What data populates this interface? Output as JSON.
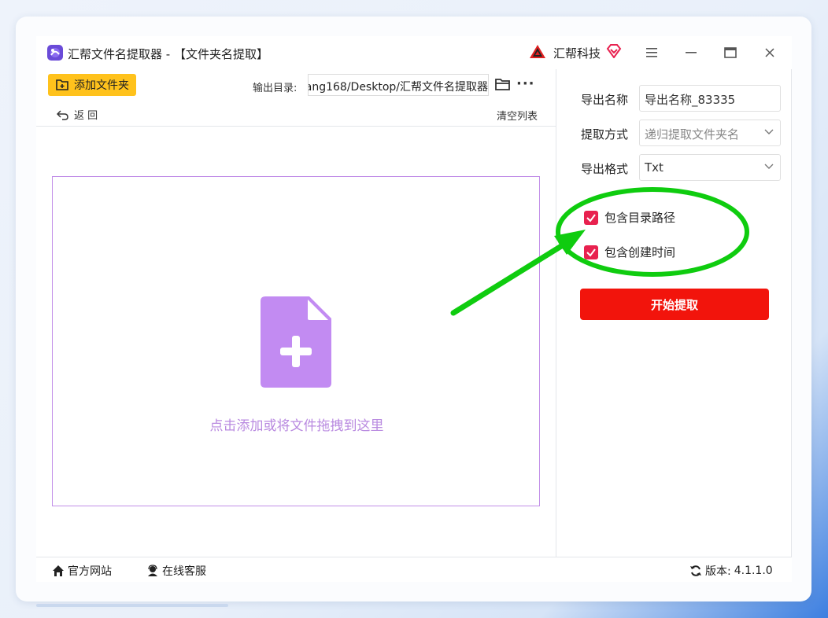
{
  "window": {
    "title": "汇帮文件名提取器 - 【文件夹名提取】",
    "brand_name": "汇帮科技"
  },
  "toolbar": {
    "add_folder_label": "添加文件夹",
    "output_dir_label": "输出目录:",
    "output_dir_value": "ang168/Desktop/汇帮文件名提取器",
    "back_label": "返 回",
    "clear_list_label": "清空列表"
  },
  "dropzone": {
    "hint": "点击添加或将文件拖拽到这里"
  },
  "settings": {
    "export_name_label": "导出名称",
    "export_name_value": "导出名称_83335",
    "extract_mode_label": "提取方式",
    "extract_mode_value": "递归提取文件夹名",
    "export_format_label": "导出格式",
    "export_format_value": "Txt",
    "include_dir_path_label": "包含目录路径",
    "include_dir_path_checked": true,
    "include_create_time_label": "包含创建时间",
    "include_create_time_checked": true,
    "start_button_label": "开始提取"
  },
  "footer": {
    "website_label": "官方网站",
    "support_label": "在线客服",
    "version_label": "版本:",
    "version_value": "4.1.1.0"
  },
  "colors": {
    "accent_yellow": "#ffc21c",
    "start_red": "#f2140c",
    "checkbox_pink": "#e8214f",
    "drop_purple": "#c18ee8",
    "annotation_green": "#0fcc0f"
  }
}
